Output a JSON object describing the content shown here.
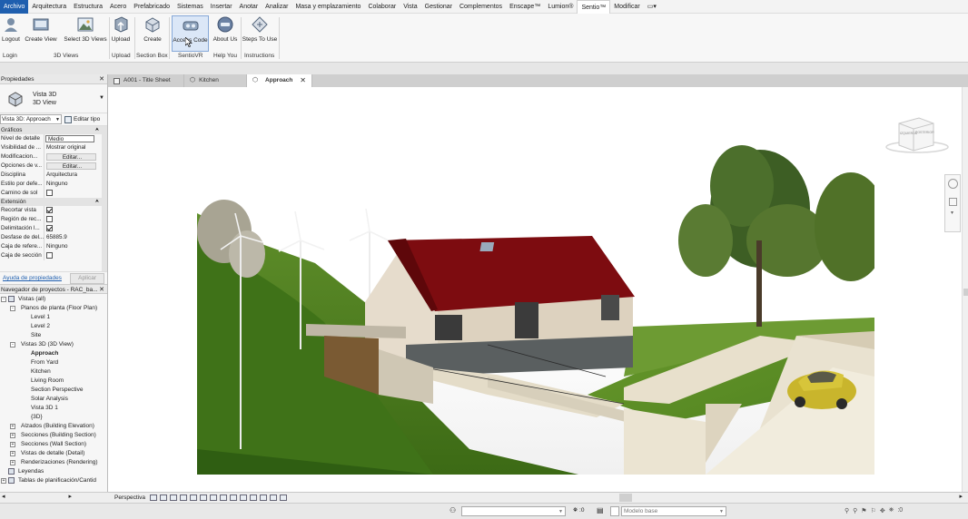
{
  "menu": [
    "Archivo",
    "Arquitectura",
    "Estructura",
    "Acero",
    "Prefabricado",
    "Sistemas",
    "Insertar",
    "Anotar",
    "Analizar",
    "Masa y emplazamiento",
    "Colaborar",
    "Vista",
    "Gestionar",
    "Complementos",
    "Enscape™",
    "Lumion®",
    "Sentio™",
    "Modificar"
  ],
  "ribbon": {
    "buttons": [
      "Logout",
      "Create View",
      "Select 3D Views",
      "Upload",
      "Create",
      "Access Code",
      "About Us",
      "Steps To Use"
    ],
    "groups": [
      "Login",
      "3D Views",
      "Upload",
      "Section Box",
      "SentioVR",
      "Help You",
      "Instructions"
    ]
  },
  "properties": {
    "title": "Propiedades",
    "type_name": "Vista 3D",
    "type_sub": "3D View",
    "selector": "Vista 3D: Approach",
    "edit_type": "Editar tipo",
    "section_graphics": "Gráficos",
    "graphics": [
      {
        "k": "Nivel de detalle",
        "v": "Medio"
      },
      {
        "k": "Visibilidad de ...",
        "v": "Mostrar original"
      },
      {
        "k": "Modificacion...",
        "v": "Editar..."
      },
      {
        "k": "Opciones de v...",
        "v": "Editar..."
      },
      {
        "k": "Disciplina",
        "v": "Arquitectura"
      },
      {
        "k": "Estilo por defe...",
        "v": "Ninguno"
      },
      {
        "k": "Camino de sol",
        "v": ""
      }
    ],
    "section_extent": "Extensión",
    "extent": [
      {
        "k": "Recortar vista",
        "v": ""
      },
      {
        "k": "Región de rec...",
        "v": ""
      },
      {
        "k": "Delimitación l...",
        "v": ""
      },
      {
        "k": "Desfase de del...",
        "v": "65885.9"
      },
      {
        "k": "Caja de refere...",
        "v": "Ninguno"
      },
      {
        "k": "Caja de sección",
        "v": ""
      }
    ],
    "help_link": "Ayuda de propiedades",
    "apply": "Aplicar"
  },
  "browser": {
    "title": "Navegador de proyectos - RAC_ba...",
    "items": [
      {
        "t": "Vistas (all)",
        "lvl": 0,
        "exp": "-"
      },
      {
        "t": "Planos de planta (Floor Plan)",
        "lvl": 1,
        "exp": "-"
      },
      {
        "t": "Level 1",
        "lvl": 2
      },
      {
        "t": "Level 2",
        "lvl": 2
      },
      {
        "t": "Site",
        "lvl": 2
      },
      {
        "t": "Vistas 3D (3D View)",
        "lvl": 1,
        "exp": "-"
      },
      {
        "t": "Approach",
        "lvl": 2,
        "bold": true
      },
      {
        "t": "From Yard",
        "lvl": 2
      },
      {
        "t": "Kitchen",
        "lvl": 2
      },
      {
        "t": "Living Room",
        "lvl": 2
      },
      {
        "t": "Section Perspective",
        "lvl": 2
      },
      {
        "t": "Solar Analysis",
        "lvl": 2
      },
      {
        "t": "Vista 3D 1",
        "lvl": 2
      },
      {
        "t": "{3D}",
        "lvl": 2
      },
      {
        "t": "Alzados (Building Elevation)",
        "lvl": 1,
        "exp": "+"
      },
      {
        "t": "Secciones (Building Section)",
        "lvl": 1,
        "exp": "+"
      },
      {
        "t": "Secciones (Wall Section)",
        "lvl": 1,
        "exp": "+"
      },
      {
        "t": "Vistas de detalle (Detail)",
        "lvl": 1,
        "exp": "+"
      },
      {
        "t": "Renderizaciones (Rendering)",
        "lvl": 1,
        "exp": "+"
      },
      {
        "t": "Leyendas",
        "lvl": 0,
        "exp": ""
      },
      {
        "t": "Tablas de planificación/Cantid",
        "lvl": 0,
        "exp": "+"
      }
    ]
  },
  "tabs": [
    {
      "label": "A001 - Title Sheet"
    },
    {
      "label": "Kitchen"
    },
    {
      "label": "Approach"
    }
  ],
  "status": {
    "view_mode": "Perspectiva",
    "model": "Modelo base",
    "count1": ":0",
    "count2": ":0"
  },
  "viewcube": {
    "left": "IZQUIERDA",
    "front": "POSTERIOR"
  }
}
